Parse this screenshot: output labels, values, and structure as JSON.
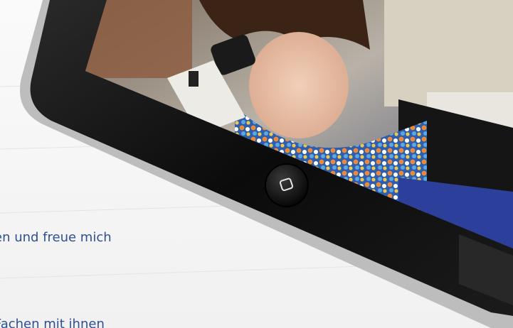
{
  "slide": {
    "text_line_1": "en und freue mich",
    "text_line_2": "Fachen mit ihnen"
  },
  "tablet": {
    "home_button_icon": "square-home-icon",
    "photo_subject": "student-with-microscope"
  },
  "colors": {
    "text": "#2f4f8f",
    "bezel": "#111111",
    "background": "#f3f3f3"
  }
}
